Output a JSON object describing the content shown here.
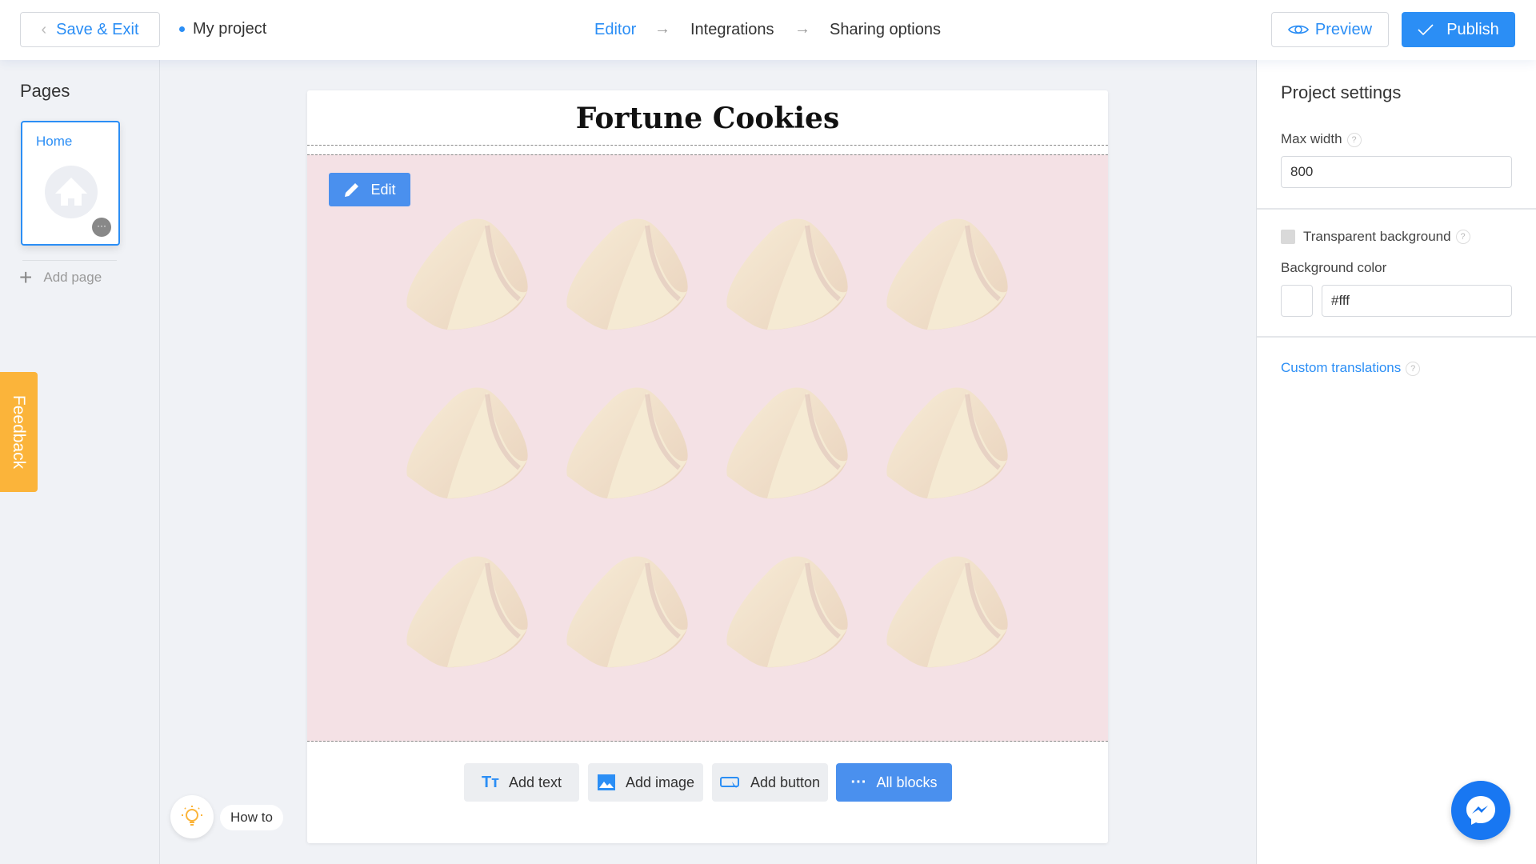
{
  "header": {
    "save_exit": "Save & Exit",
    "project_name": "My project",
    "steps": [
      "Editor",
      "Integrations",
      "Sharing options"
    ],
    "active_step": "Editor",
    "preview": "Preview",
    "publish": "Publish"
  },
  "left": {
    "title": "Pages",
    "pages": [
      {
        "label": "Home"
      }
    ],
    "add_page": "Add page",
    "feedback": "Feedback",
    "how_to": "How to"
  },
  "canvas": {
    "title": "Fortune Cookies",
    "edit": "Edit",
    "background": "#f4e1e5",
    "cookie_rows": 3,
    "cookie_cols": 4
  },
  "toolbar": {
    "add_text": "Add text",
    "add_image": "Add image",
    "add_button": "Add button",
    "all_blocks": "All blocks"
  },
  "settings": {
    "title": "Project settings",
    "max_width_label": "Max width",
    "max_width": "800",
    "transparent_label": "Transparent background",
    "transparent_checked": false,
    "bg_color_label": "Background color",
    "bg_color": "#fff",
    "custom_translations": "Custom translations",
    "help": "?"
  },
  "colors": {
    "accent": "#2b8ef5",
    "feedback": "#fbb43a",
    "messenger": "#1877f2"
  }
}
